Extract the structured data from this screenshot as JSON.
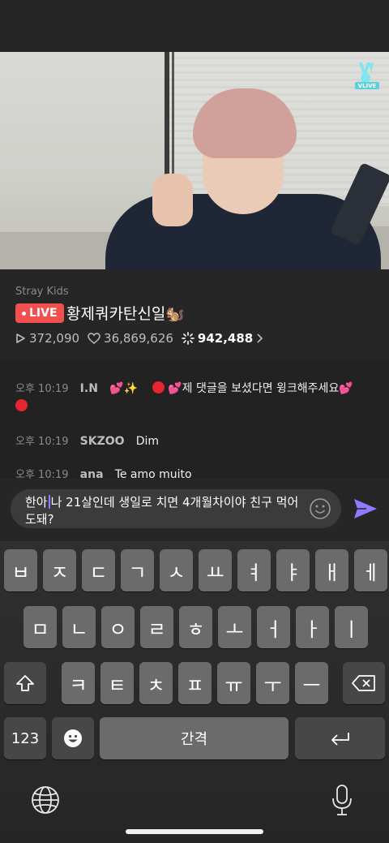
{
  "stream": {
    "channel": "Stray Kids",
    "live_label": "LIVE",
    "title": "황제쿼카탄신일🐿️",
    "views": "372,090",
    "likes": "36,869,626",
    "sparkles": "942,488",
    "brand_logo": "VLIVE"
  },
  "chat": [
    {
      "time": "오후 10:19",
      "name": "I.N",
      "message": "💕✨"
    },
    {
      "time": "",
      "name": "",
      "message": "💕제 댓글을 보셨다면 윙크해주세요💕"
    },
    {
      "time": "오후 10:19",
      "name": "SKZOO",
      "message": "Dim"
    },
    {
      "time": "오후 10:19",
      "name": "ana",
      "message": "Te amo muito"
    }
  ],
  "composer": {
    "text_before_caret": "한아",
    "text_after_caret": "나 21살인데 생일로 치면 4개월차이야 친구 먹어도돼?"
  },
  "keyboard": {
    "row1": [
      "ㅂ",
      "ㅈ",
      "ㄷ",
      "ㄱ",
      "ㅅ",
      "ㅛ",
      "ㅕ",
      "ㅑ",
      "ㅐ",
      "ㅔ"
    ],
    "row2": [
      "ㅁ",
      "ㄴ",
      "ㅇ",
      "ㄹ",
      "ㅎ",
      "ㅗ",
      "ㅓ",
      "ㅏ",
      "ㅣ"
    ],
    "row3": [
      "ㅋ",
      "ㅌ",
      "ㅊ",
      "ㅍ",
      "ㅠ",
      "ㅜ",
      "ㅡ"
    ],
    "numbers_label": "123",
    "space_label": "간격"
  },
  "colors": {
    "accent": "#8e7bff",
    "live": "#f24f4f",
    "background": "#222222"
  }
}
